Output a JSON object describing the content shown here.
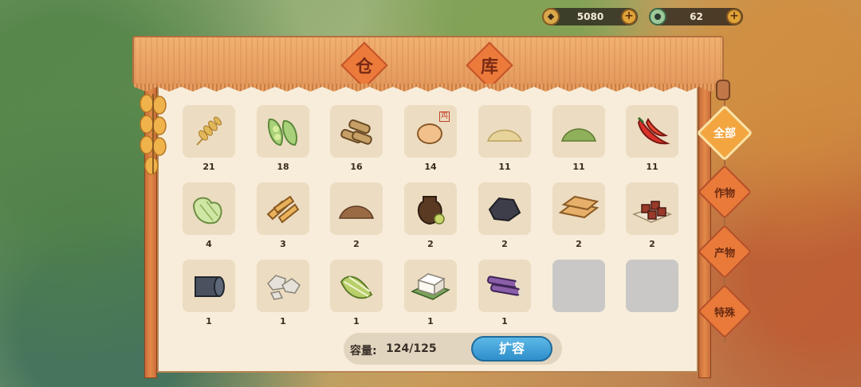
{
  "currency": {
    "coins": {
      "value": "5080",
      "icon": "coin-icon",
      "plus": "+"
    },
    "jade": {
      "value": "62",
      "icon": "jade-icon",
      "plus": "+"
    }
  },
  "title": {
    "char1": "仓",
    "char2": "库"
  },
  "items": [
    {
      "name": "wheat",
      "qty": "21"
    },
    {
      "name": "soybean",
      "qty": "18"
    },
    {
      "name": "sugarcane-logs",
      "qty": "16"
    },
    {
      "name": "chicken-egg",
      "qty": "14",
      "tag": "鸡"
    },
    {
      "name": "flour-pile",
      "qty": "11"
    },
    {
      "name": "green-powder-pile",
      "qty": "11"
    },
    {
      "name": "red-chili",
      "qty": "11"
    },
    {
      "name": "cabbage",
      "qty": "4"
    },
    {
      "name": "tofu-skin",
      "qty": "3"
    },
    {
      "name": "brown-powder-pile",
      "qty": "2"
    },
    {
      "name": "sauce-jar",
      "qty": "2"
    },
    {
      "name": "charcoal",
      "qty": "2"
    },
    {
      "name": "wood-planks",
      "qty": "2"
    },
    {
      "name": "brown-sugar-cubes",
      "qty": "2"
    },
    {
      "name": "cloth-roll",
      "qty": "1"
    },
    {
      "name": "stones",
      "qty": "1"
    },
    {
      "name": "chinese-cabbage",
      "qty": "1"
    },
    {
      "name": "tofu",
      "qty": "1"
    },
    {
      "name": "purple-sugarcane",
      "qty": "1"
    }
  ],
  "capacity": {
    "label": "容量:",
    "value": "124/125"
  },
  "expand_button": "扩容",
  "tabs": [
    {
      "label": "全部",
      "active": true
    },
    {
      "label": "作物",
      "active": false
    },
    {
      "label": "产物",
      "active": false
    },
    {
      "label": "特殊",
      "active": false
    }
  ]
}
